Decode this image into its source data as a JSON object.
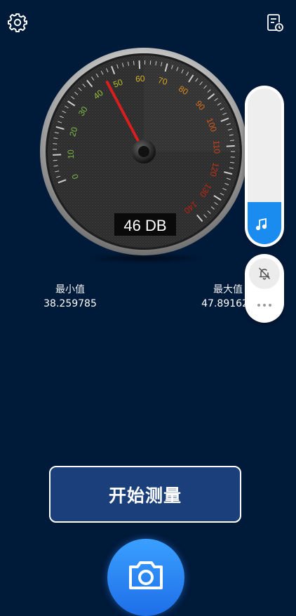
{
  "meter": {
    "reading_db": 46,
    "display_text": "46 DB",
    "scale_min": 0,
    "scale_max": 140,
    "tick_labels": [
      "0",
      "10",
      "20",
      "30",
      "40",
      "50",
      "60",
      "70",
      "80",
      "90",
      "100",
      "110",
      "120",
      "130",
      "140"
    ],
    "tick_label_colors": [
      "#7ab648",
      "#7ab648",
      "#7ab648",
      "#7ab648",
      "#9ac23c",
      "#b8c22c",
      "#d7b52a",
      "#d9a321",
      "#d98a1e",
      "#d9731b",
      "#d35a18",
      "#cc4114",
      "#c93214",
      "#c32511",
      "#bf1f10"
    ],
    "needle_color": "#d81e1e"
  },
  "stats": {
    "min_label": "最小值",
    "min_value": "38.259785",
    "max_label": "最大值",
    "max_value": "47.891624"
  },
  "volume": {
    "level": 0.27,
    "accent": "#1a8cf0"
  },
  "actions": {
    "start_label": "开始测量"
  },
  "icons": {
    "settings": "gear-icon",
    "history": "history-doc-icon",
    "music": "music-note-icon",
    "bell": "bell-off-icon",
    "more": "more-dots-icon",
    "camera": "camera-icon"
  },
  "colors": {
    "background": "#001a3a",
    "button": "#1a3f7a",
    "fab": "#1e6ee8"
  }
}
